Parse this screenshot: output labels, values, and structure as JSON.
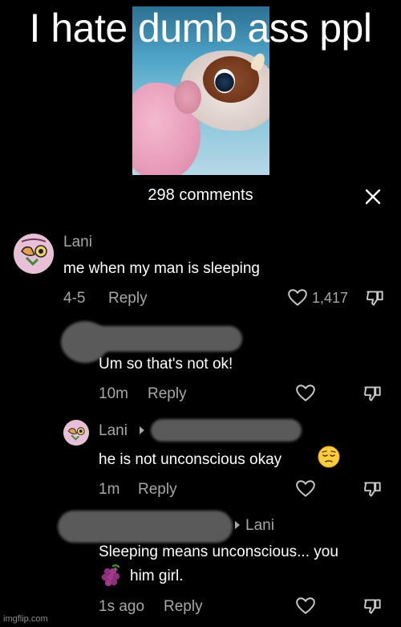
{
  "meme": {
    "title": "I hate dumb ass ppl",
    "watermark": "imgflip.com"
  },
  "header": {
    "count_label": "298 comments"
  },
  "comments": [
    {
      "username": "Lani",
      "text": "me when my man is sleeping",
      "time": "4-5",
      "reply_label": "Reply",
      "likes": "1,417"
    },
    {
      "username": "",
      "text": "Um so that's not ok!",
      "time": "10m",
      "reply_label": "Reply"
    },
    {
      "username": "Lani",
      "text": "he is not unconscious okay",
      "time": "1m",
      "reply_label": "Reply",
      "emoji": "pensive-face"
    },
    {
      "username": "",
      "reply_to": "Lani",
      "text_line1": "Sleeping means unconscious... you",
      "text_line2": "him girl.",
      "time": "1s ago",
      "reply_label": "Reply",
      "emoji": "grapes"
    }
  ],
  "colors": {
    "background": "#000000",
    "muted": "#a7a7a7",
    "text": "#ffffff",
    "redaction": "#5a5a5a"
  }
}
